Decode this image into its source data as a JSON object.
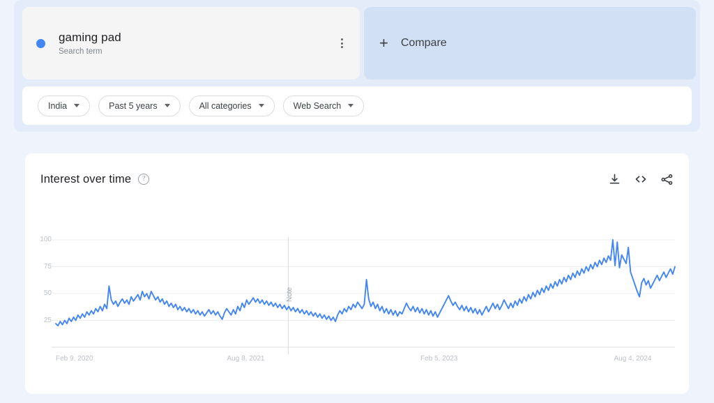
{
  "query": {
    "term": "gaming pad",
    "term_subtitle": "Search term",
    "menu_icon": "kebab-menu-icon",
    "compare_label": "Compare",
    "compare_plus": "+"
  },
  "filters": [
    {
      "label": "India"
    },
    {
      "label": "Past 5 years"
    },
    {
      "label": "All categories"
    },
    {
      "label": "Web Search"
    }
  ],
  "chart_card": {
    "title": "Interest over time",
    "help": "?",
    "actions": [
      "download-icon",
      "embed-icon",
      "share-icon"
    ]
  },
  "colors": {
    "series": "#4285f4",
    "page_bg": "#eff3fb",
    "panel_bg": "#e4ecf9",
    "term_card_bg": "#f5f5f5",
    "compare_card_bg": "#d2e0f5",
    "card_bg": "#ffffff",
    "grid": "#ecedef",
    "axis_text": "#bdc1c6"
  },
  "chart_data": {
    "type": "line",
    "title": "Interest over time",
    "xlabel": "",
    "ylabel": "",
    "ylim": [
      0,
      100
    ],
    "grid": true,
    "legend": false,
    "yticks": [
      25,
      50,
      75,
      100
    ],
    "xticks": [
      "Feb 9, 2020",
      "Aug 8, 2021",
      "Feb 5, 2023",
      "Aug 4, 2024"
    ],
    "xtick_positions": [
      0,
      0.3125,
      0.625,
      0.9375
    ],
    "annotations": [
      {
        "label": "Note",
        "x_fraction": 0.3755
      }
    ],
    "series": [
      {
        "name": "gaming pad",
        "color": "#4285f4",
        "values": [
          22,
          20,
          24,
          21,
          25,
          22,
          27,
          24,
          28,
          25,
          30,
          27,
          31,
          28,
          33,
          30,
          34,
          31,
          36,
          33,
          38,
          34,
          40,
          36,
          57,
          44,
          40,
          43,
          38,
          42,
          45,
          41,
          44,
          40,
          47,
          43,
          46,
          49,
          44,
          52,
          47,
          50,
          45,
          52,
          48,
          44,
          47,
          42,
          45,
          40,
          43,
          38,
          41,
          37,
          40,
          35,
          38,
          34,
          37,
          33,
          36,
          32,
          35,
          31,
          34,
          30,
          33,
          29,
          32,
          35,
          31,
          34,
          30,
          33,
          29,
          26,
          32,
          36,
          33,
          30,
          35,
          31,
          38,
          34,
          41,
          37,
          44,
          40,
          43,
          46,
          42,
          45,
          41,
          44,
          40,
          43,
          39,
          42,
          38,
          41,
          37,
          40,
          36,
          39,
          35,
          38,
          34,
          37,
          33,
          36,
          32,
          35,
          31,
          34,
          30,
          33,
          29,
          32,
          28,
          31,
          27,
          30,
          26,
          29,
          25,
          28,
          24,
          30,
          34,
          31,
          36,
          33,
          38,
          35,
          40,
          37,
          42,
          39,
          36,
          40,
          63,
          45,
          38,
          42,
          36,
          40,
          34,
          38,
          32,
          36,
          31,
          35,
          30,
          34,
          29,
          33,
          31,
          36,
          41,
          37,
          34,
          38,
          33,
          37,
          32,
          36,
          31,
          35,
          30,
          34,
          29,
          33,
          28,
          32,
          36,
          40,
          44,
          48,
          43,
          39,
          42,
          38,
          35,
          39,
          34,
          38,
          33,
          37,
          32,
          36,
          31,
          35,
          30,
          34,
          38,
          33,
          37,
          41,
          36,
          40,
          35,
          39,
          44,
          40,
          36,
          41,
          37,
          43,
          39,
          45,
          41,
          47,
          43,
          49,
          45,
          51,
          47,
          53,
          49,
          55,
          51,
          57,
          53,
          59,
          55,
          61,
          57,
          63,
          59,
          65,
          61,
          67,
          63,
          69,
          65,
          71,
          67,
          73,
          69,
          75,
          71,
          77,
          73,
          79,
          75,
          81,
          77,
          83,
          79,
          85,
          81,
          100,
          76,
          98,
          74,
          86,
          82,
          78,
          93,
          70,
          64,
          58,
          52,
          47,
          60,
          64,
          58,
          62,
          55,
          59,
          63,
          67,
          62,
          66,
          70,
          65,
          69,
          73,
          68,
          75
        ]
      }
    ]
  }
}
